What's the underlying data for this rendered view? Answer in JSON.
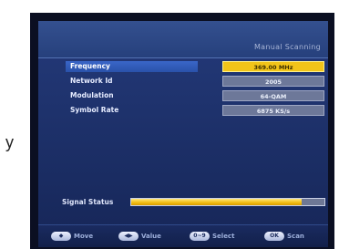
{
  "side_letter": "y",
  "title": "Manual Scanning",
  "rows": [
    {
      "label": "Frequency",
      "value": "369.00 MHz"
    },
    {
      "label": "Network Id",
      "value": "2005"
    },
    {
      "label": "Modulation",
      "value": "64-QAM"
    },
    {
      "label": "Symbol Rate",
      "value": "6875 KS/s"
    }
  ],
  "signal": {
    "label": "Signal Status",
    "level_fraction": 0.88
  },
  "help": [
    {
      "key": "◆",
      "label": "Move",
      "icon": "move-icon"
    },
    {
      "key": "◀▶",
      "label": "Value",
      "icon": "value-icon"
    },
    {
      "key": "0~9",
      "label": "Select",
      "icon": "number-keys-icon"
    },
    {
      "key": "OK",
      "label": "Scan",
      "icon": "ok-key-icon"
    }
  ],
  "colors": {
    "screen_blue": "#1c2f67",
    "selected_blue": "#2a52aa",
    "selected_value_yellow": "#f2c419",
    "value_box_gray": "#6d7899"
  }
}
